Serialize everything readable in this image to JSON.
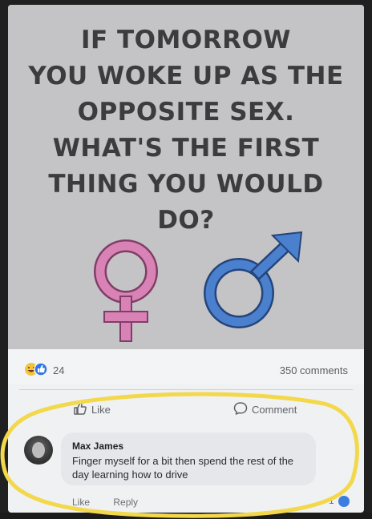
{
  "post": {
    "headline_lines": [
      "IF TOMORROW",
      "YOU WOKE UP AS THE",
      "OPPOSITE SEX.",
      "WHAT'S THE FIRST",
      "THING YOU WOULD",
      "DO?"
    ],
    "symbols": [
      "female-symbol-icon",
      "male-symbol-icon"
    ],
    "colors": {
      "female": "#d982b6",
      "male": "#4b80cf",
      "highlight": "#f2d84a"
    }
  },
  "stats": {
    "reaction_count": "24",
    "comments_count": "350 comments"
  },
  "actions": {
    "like_label": "Like",
    "comment_label": "Comment"
  },
  "comment": {
    "author": "Max James",
    "text": "Finger myself for a bit then spend the rest of the day learning how to drive",
    "like_label": "Like",
    "reply_label": "Reply",
    "reaction_count": "1"
  }
}
